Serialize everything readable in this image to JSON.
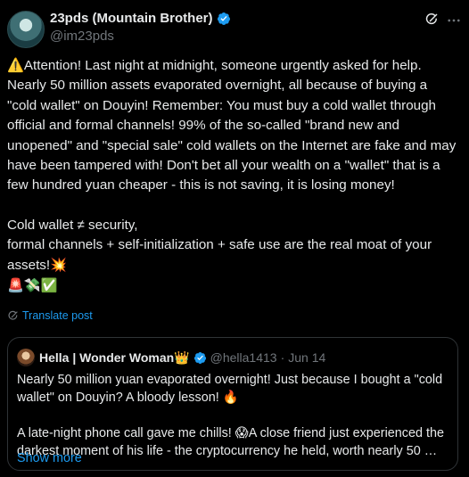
{
  "tweet": {
    "author_name": "23pds (Mountain Brother)",
    "author_handle": "@im23pds",
    "paragraph1": "⚠️Attention! Last night at midnight, someone urgently asked for help. Nearly 50 million assets evaporated overnight, all because of buying a \"cold wallet\" on Douyin! Remember: You must buy a cold wallet through official and formal channels! 99% of the so-called \"brand new and unopened\" and \"special sale\" cold wallets on the Internet are fake and may have been tampered with! Don't bet all your wealth on a \"wallet\" that is a few hundred yuan cheaper - this is not saving, it is losing money!",
    "paragraph2_line1": "Cold wallet ≠ security,",
    "paragraph2_line2": " formal channels + self-initialization + safe use are the real moat of your assets!💥",
    "emoji_line": "🚨💸✅",
    "translate_label": "Translate post"
  },
  "quote": {
    "author_name": "Hella | Wonder Woman👑",
    "author_handle": "@hella1413",
    "separator": "·",
    "date": "Jun 14",
    "paragraph1": "Nearly 50 million yuan evaporated overnight! Just because I bought a \"cold wallet\" on Douyin? A bloody lesson! 🔥",
    "paragraph2": "A late-night phone call gave me chills! 😱A close friend just experienced the darkest moment of his life - the cryptocurrency he held, worth nearly 50 …",
    "show_more": "Show more"
  },
  "colors": {
    "background": "#000000",
    "text": "#e7e9ea",
    "muted": "#71767b",
    "accent": "#1d9bf0",
    "border": "#2f3336"
  },
  "icons": [
    "verified-badge-icon",
    "grok-icon",
    "more-options-icon",
    "translate-icon"
  ]
}
